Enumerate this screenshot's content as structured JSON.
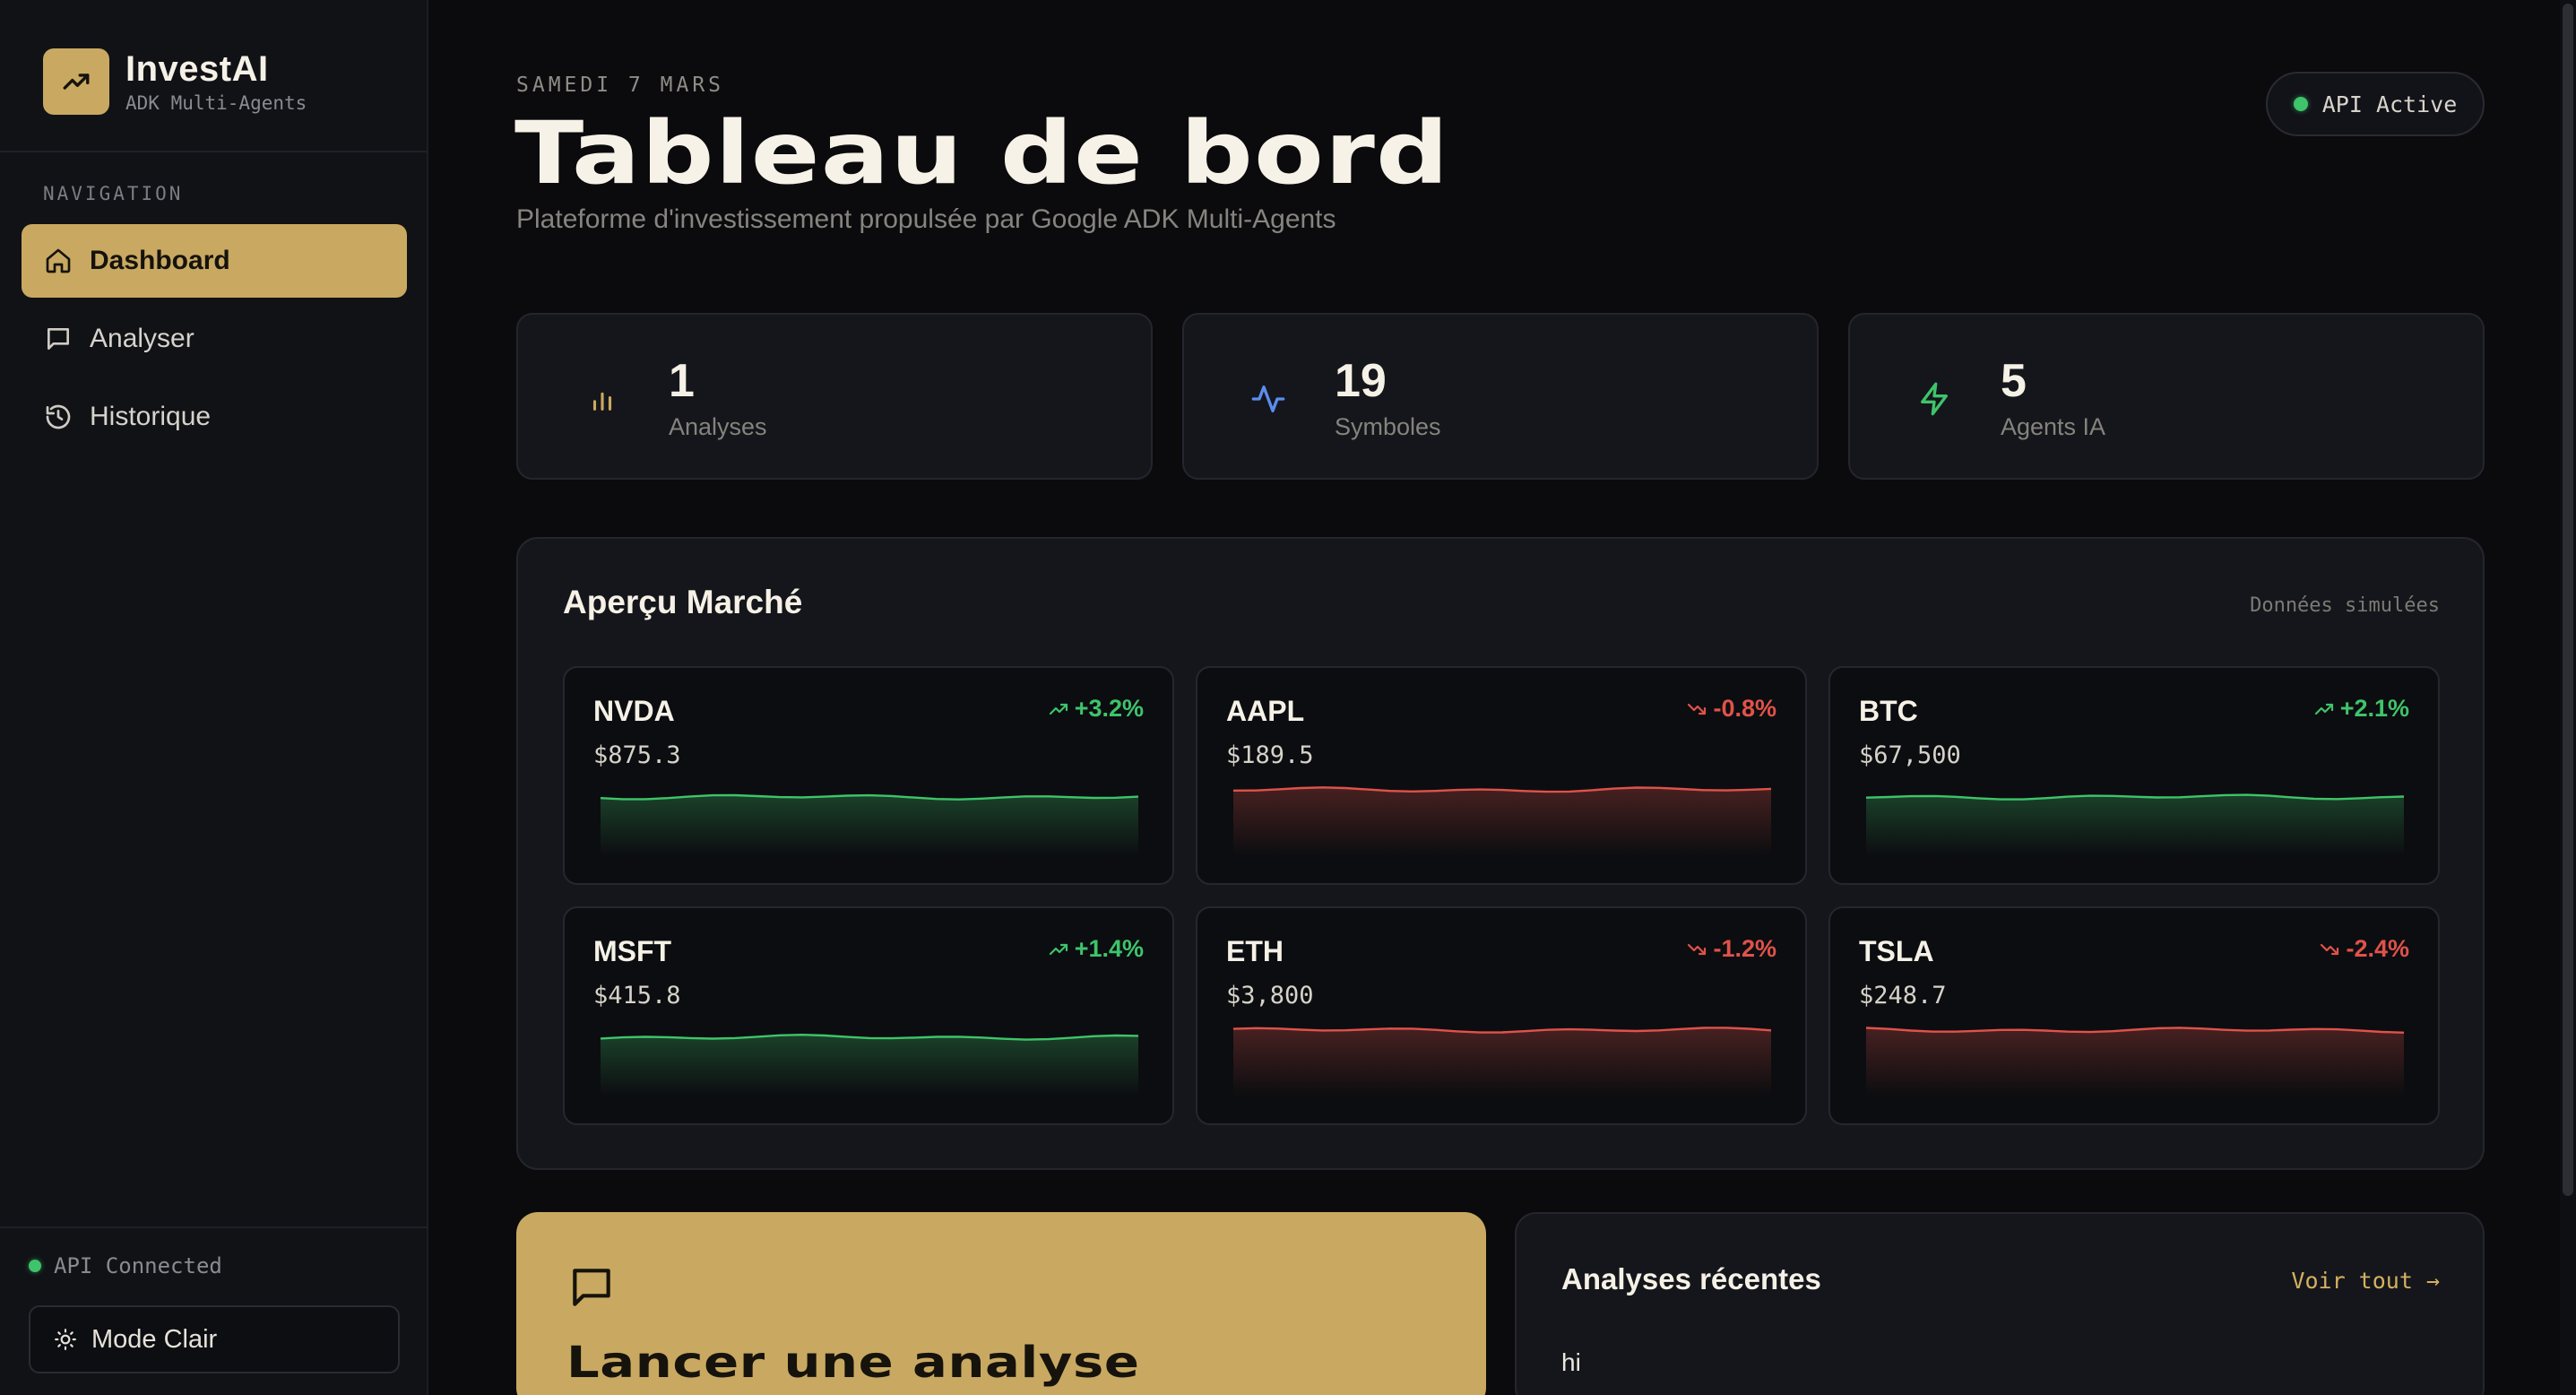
{
  "brand": {
    "title": "InvestAI",
    "subtitle": "ADK Multi-Agents"
  },
  "sidebar": {
    "nav_label": "NAVIGATION",
    "items": [
      {
        "label": "Dashboard",
        "icon": "home-icon",
        "active": true
      },
      {
        "label": "Analyser",
        "icon": "message-icon",
        "active": false
      },
      {
        "label": "Historique",
        "icon": "history-icon",
        "active": false
      }
    ],
    "status": "API Connected",
    "mode_button": "Mode Clair"
  },
  "header": {
    "date": "SAMEDI 7 MARS",
    "title": "Tableau de bord",
    "subtitle": "Plateforme d'investissement propulsée par Google ADK Multi-Agents",
    "api_badge": "API Active"
  },
  "stats": [
    {
      "value": "1",
      "label": "Analyses",
      "icon": "bar-chart-icon"
    },
    {
      "value": "19",
      "label": "Symboles",
      "icon": "activity-icon"
    },
    {
      "value": "5",
      "label": "Agents IA",
      "icon": "zap-icon"
    }
  ],
  "market": {
    "title": "Aperçu Marché",
    "note": "Données simulées",
    "tickers": [
      {
        "symbol": "NVDA",
        "price": "$875.3",
        "change": "+3.2%",
        "trend": "up"
      },
      {
        "symbol": "AAPL",
        "price": "$189.5",
        "change": "-0.8%",
        "trend": "down"
      },
      {
        "symbol": "BTC",
        "price": "$67,500",
        "change": "+2.1%",
        "trend": "up"
      },
      {
        "symbol": "MSFT",
        "price": "$415.8",
        "change": "+1.4%",
        "trend": "up"
      },
      {
        "symbol": "ETH",
        "price": "$3,800",
        "change": "-1.2%",
        "trend": "down"
      },
      {
        "symbol": "TSLA",
        "price": "$248.7",
        "change": "-2.4%",
        "trend": "down"
      }
    ]
  },
  "cta": {
    "title": "Lancer une analyse",
    "icon": "message-icon"
  },
  "recent": {
    "title": "Analyses récentes",
    "link": "Voir tout →",
    "items": [
      {
        "name": "hi"
      }
    ]
  },
  "colors": {
    "accent": "#c9a961",
    "up": "#3ec46a",
    "down": "#e0524a",
    "blue": "#5b8def"
  }
}
